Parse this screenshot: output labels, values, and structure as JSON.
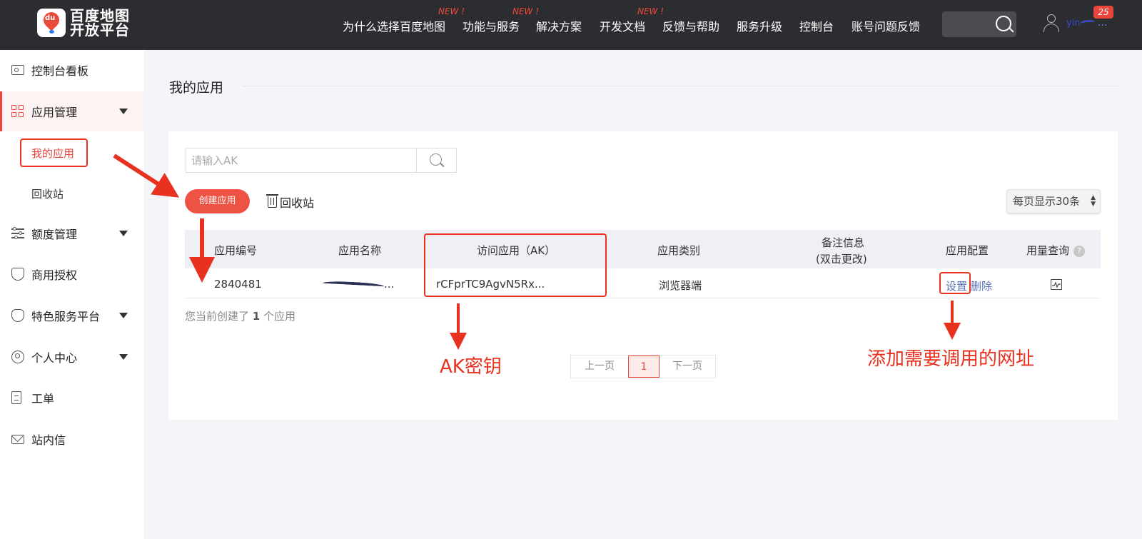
{
  "brand": {
    "logo_badge": "du",
    "logo_line1": "百度地图",
    "logo_line2": "开放平台"
  },
  "nav": {
    "items": [
      {
        "label": "为什么选择百度地图",
        "new": ""
      },
      {
        "label": "功能与服务",
        "new": "NEW !"
      },
      {
        "label": "解决方案",
        "new": "NEW !"
      },
      {
        "label": "开发文档",
        "new": "NEW !"
      },
      {
        "label": "反馈与帮助",
        "new": ""
      },
      {
        "label": "服务升级",
        "new": ""
      },
      {
        "label": "控制台",
        "new": ""
      },
      {
        "label": "账号问题反馈",
        "new": ""
      }
    ],
    "new_1": "NEW !",
    "new_2": "NEW !",
    "new_3": "NEW !",
    "username_visible": "yin",
    "notification_count": "25"
  },
  "sidebar": {
    "items": [
      {
        "label": "控制台看板",
        "icon": "id-card-icon"
      },
      {
        "label": "应用管理",
        "icon": "grid-icon",
        "expanded": true
      },
      {
        "label": "额度管理",
        "icon": "sliders-icon"
      },
      {
        "label": "商用授权",
        "icon": "shield-check-icon"
      },
      {
        "label": "特色服务平台",
        "icon": "heart-icon"
      },
      {
        "label": "个人中心",
        "icon": "user-circle-icon"
      },
      {
        "label": "工单",
        "icon": "clipboard-icon"
      },
      {
        "label": "站内信",
        "icon": "mail-icon"
      }
    ],
    "sub_items": [
      "我的应用",
      "回收站"
    ]
  },
  "main": {
    "title": "我的应用",
    "search_placeholder": "请输入AK",
    "create_button": "创建应用",
    "recycle_label": "回收站",
    "per_page": "每页显示30条",
    "columns": [
      "应用编号",
      "应用名称",
      "访问应用（AK）",
      "应用类别",
      "备注信息",
      "(双击更改)",
      "应用配置",
      "用量查询"
    ],
    "help_glyph": "?",
    "row": {
      "app_id": "2840481",
      "app_name_suffix": "...",
      "ak": "rCFprTC9AgvN5Rx...",
      "category": "浏览器端",
      "remark": "",
      "action_settings": "设置",
      "action_delete": "删除"
    },
    "count_prefix": "您当前创建了",
    "count_value": "1",
    "count_suffix": "个应用",
    "pager": {
      "prev": "上一页",
      "current": "1",
      "next": "下一页"
    }
  },
  "annotations": {
    "ak_label": "AK密钥",
    "url_label": "添加需要调用的网址"
  },
  "colors": {
    "accent": "#e8453c",
    "topbar": "#2b2d31",
    "annotation": "#e8311f"
  }
}
